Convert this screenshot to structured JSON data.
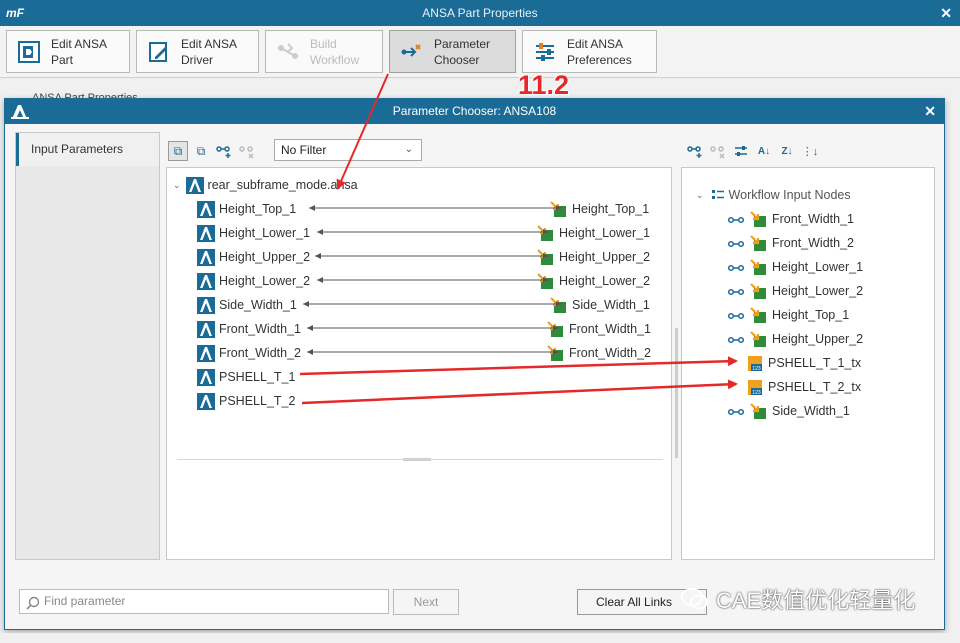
{
  "app": {
    "logo": "mF",
    "title": "ANSA Part Properties"
  },
  "toolbar": {
    "buttons": [
      {
        "label": "Edit ANSA\nPart"
      },
      {
        "label": "Edit ANSA\nDriver"
      },
      {
        "label": "Build\nWorkflow"
      },
      {
        "label": "Parameter\nChooser"
      },
      {
        "label": "Edit ANSA\nPreferences"
      }
    ]
  },
  "background_text": "ANSA Part Properties",
  "annotation": "11.2",
  "dialog": {
    "title": "Parameter Chooser: ANSA108",
    "left_tab": "Input Parameters",
    "filter": {
      "value": "No Filter"
    },
    "tree_root": "rear_subframe_mode.ansa",
    "parameters": [
      {
        "name": "Height_Top_1",
        "link": "Height_Top_1"
      },
      {
        "name": "Height_Lower_1",
        "link": "Height_Lower_1"
      },
      {
        "name": "Height_Upper_2",
        "link": "Height_Upper_2"
      },
      {
        "name": "Height_Lower_2",
        "link": "Height_Lower_2"
      },
      {
        "name": "Side_Width_1",
        "link": "Side_Width_1"
      },
      {
        "name": "Front_Width_1",
        "link": "Front_Width_1"
      },
      {
        "name": "Front_Width_2",
        "link": "Front_Width_2"
      },
      {
        "name": "PSHELL_T_1",
        "link": ""
      },
      {
        "name": "PSHELL_T_2",
        "link": ""
      }
    ],
    "workflow": {
      "header": "Workflow Input Nodes",
      "nodes": [
        {
          "name": "Front_Width_1",
          "kind": "link"
        },
        {
          "name": "Front_Width_2",
          "kind": "link"
        },
        {
          "name": "Height_Lower_1",
          "kind": "link"
        },
        {
          "name": "Height_Lower_2",
          "kind": "link"
        },
        {
          "name": "Height_Top_1",
          "kind": "link"
        },
        {
          "name": "Height_Upper_2",
          "kind": "link"
        },
        {
          "name": "PSHELL_T_1_tx",
          "kind": "table"
        },
        {
          "name": "PSHELL_T_2_tx",
          "kind": "table"
        },
        {
          "name": "Side_Width_1",
          "kind": "link"
        }
      ]
    },
    "search_placeholder": "Find parameter",
    "next_label": "Next",
    "clear_label": "Clear All Links"
  },
  "watermark": "CAE数值优化轻量化",
  "colors": {
    "titlebar": "#1b6b97",
    "annotation": "#e52828",
    "link_arrow": "#555555"
  }
}
